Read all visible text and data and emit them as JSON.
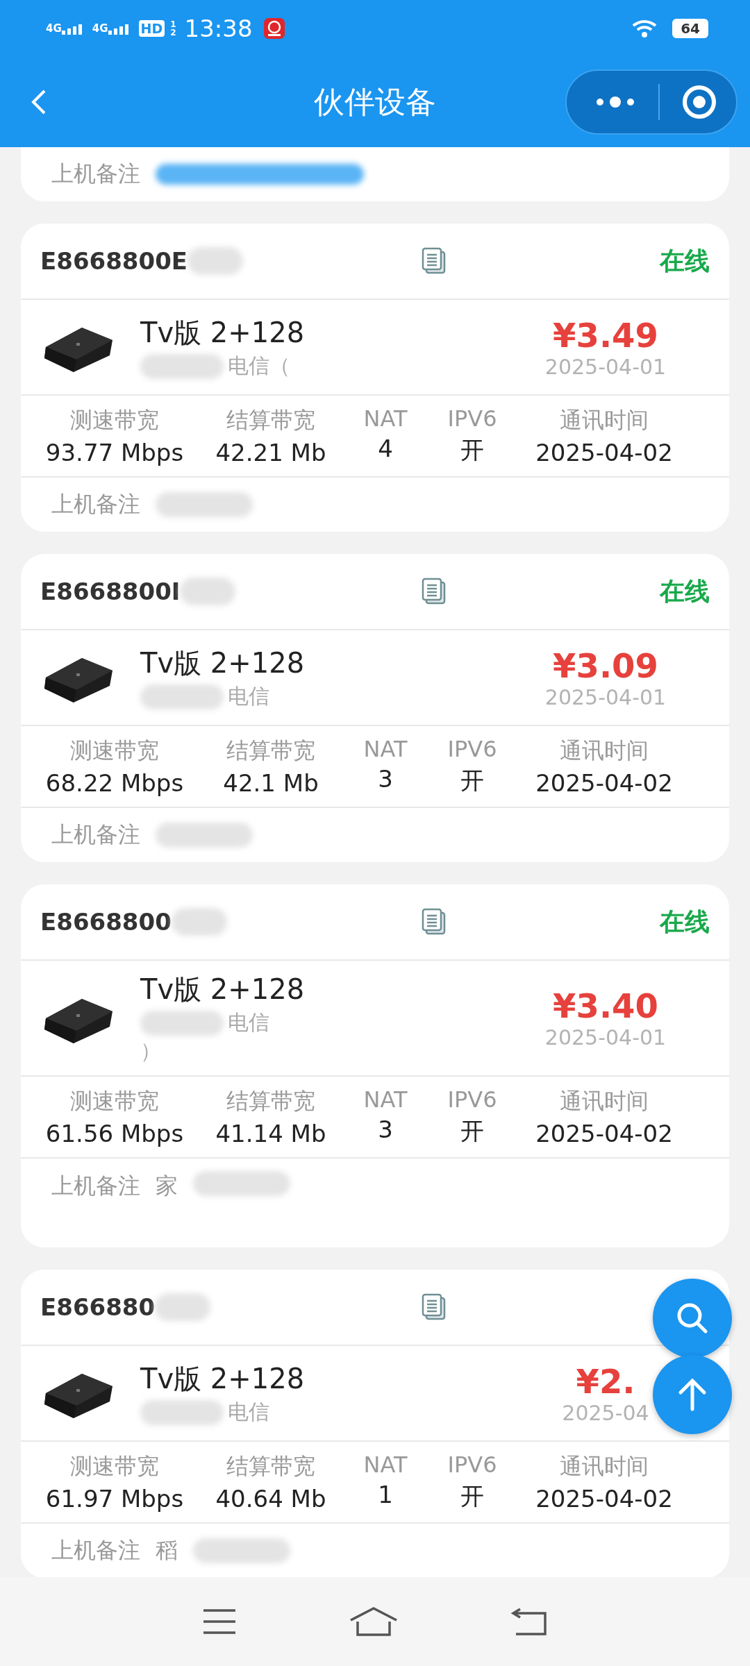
{
  "status_bar": {
    "networks": [
      "4G",
      "4G"
    ],
    "hd": "HD",
    "hd_slots": [
      "1",
      "2"
    ],
    "time": "13:38",
    "battery": "64"
  },
  "header": {
    "title": "伙伴设备"
  },
  "partial_card": {
    "remark_label": "上机备注"
  },
  "devices": [
    {
      "id": "E8668800E",
      "status": "在线",
      "online": true,
      "name": "Tv版 2+128",
      "carrier_lines": [
        "电信（"
      ],
      "price": "¥3.49",
      "date": "2025-04-01",
      "stats": [
        {
          "label": "测速带宽",
          "value": "93.77 Mbps"
        },
        {
          "label": "结算带宽",
          "value": "42.21 Mb"
        },
        {
          "label": "NAT",
          "value": "4"
        },
        {
          "label": "IPV6",
          "value": "开"
        },
        {
          "label": "通讯时间",
          "value": "2025-04-02"
        }
      ],
      "remark_label": "上机备注",
      "remark_two_lines": false
    },
    {
      "id": "E8668800I",
      "status": "在线",
      "online": true,
      "name": "Tv版 2+128",
      "carrier_lines": [
        "电信"
      ],
      "price": "¥3.09",
      "date": "2025-04-01",
      "stats": [
        {
          "label": "测速带宽",
          "value": "68.22 Mbps"
        },
        {
          "label": "结算带宽",
          "value": "42.1 Mb"
        },
        {
          "label": "NAT",
          "value": "3"
        },
        {
          "label": "IPV6",
          "value": "开"
        },
        {
          "label": "通讯时间",
          "value": "2025-04-02"
        }
      ],
      "remark_label": "上机备注",
      "remark_two_lines": false
    },
    {
      "id": "E8668800",
      "status": "在线",
      "online": true,
      "name": "Tv版 2+128",
      "carrier_lines": [
        "电信",
        "）"
      ],
      "price": "¥3.40",
      "date": "2025-04-01",
      "stats": [
        {
          "label": "测速带宽",
          "value": "61.56 Mbps"
        },
        {
          "label": "结算带宽",
          "value": "41.14 Mb"
        },
        {
          "label": "NAT",
          "value": "3"
        },
        {
          "label": "IPV6",
          "value": "开"
        },
        {
          "label": "通讯时间",
          "value": "2025-04-02"
        }
      ],
      "remark_label": "上机备注",
      "remark": "家",
      "remark_two_lines": true
    },
    {
      "id": "E866880",
      "name": "Tv版 2+128",
      "carrier_lines": [
        "电信"
      ],
      "price": "¥2.",
      "date": "2025-04",
      "stats": [
        {
          "label": "测速带宽",
          "value": "61.97 Mbps"
        },
        {
          "label": "结算带宽",
          "value": "40.64 Mb"
        },
        {
          "label": "NAT",
          "value": "1"
        },
        {
          "label": "IPV6",
          "value": "开"
        },
        {
          "label": "通讯时间",
          "value": "2025-04-02"
        }
      ],
      "remark_label": "上机备注",
      "remark": "稻",
      "remark_two_lines": false
    }
  ]
}
